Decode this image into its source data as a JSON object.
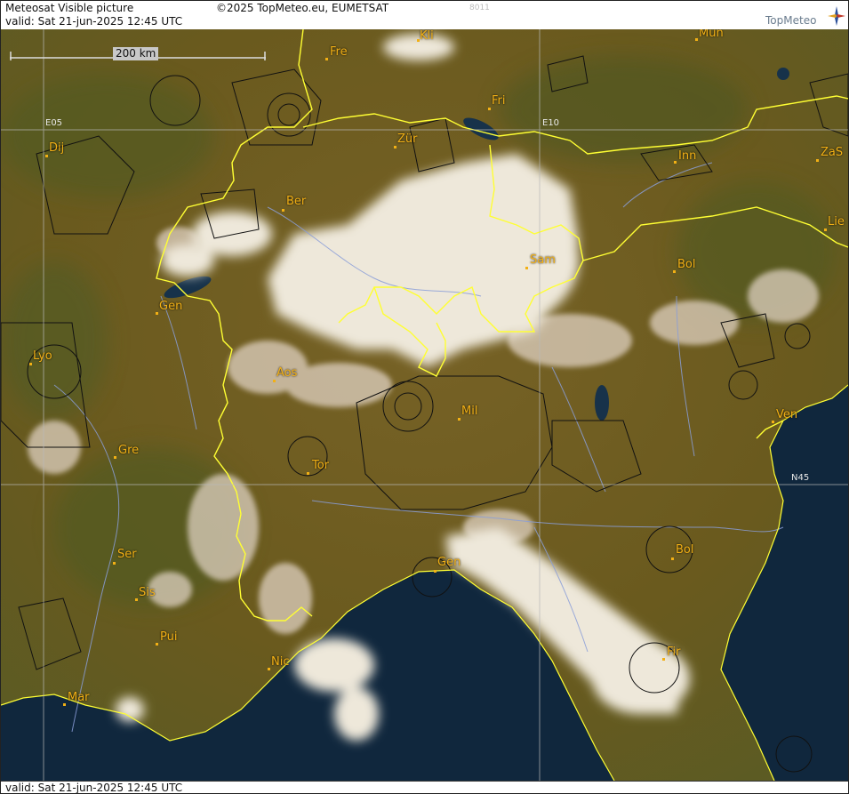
{
  "header": {
    "title": "Meteosat Visible picture",
    "copyright": "©2025 TopMeteo.eu, EUMETSAT",
    "code": "8011",
    "valid": "valid:  Sat  21-jun-2025  12:45 UTC",
    "logo": "TopMeteo"
  },
  "footer": {
    "valid": "valid:  Sat  21-jun-2025  12:45 UTC"
  },
  "scale": {
    "label": "200 km"
  },
  "grid": {
    "lon_left": "E05",
    "lon_right": "E10",
    "lat": "N45"
  },
  "colors": {
    "land": "#6e5c1f",
    "sea": "#10273d",
    "cloud": "#ece6d6",
    "border": "#ffff33",
    "river": "#8a9ed8",
    "label": "#f2b015"
  },
  "cities": [
    "Kli",
    "Mun",
    "Fre",
    "Fri",
    "Dij",
    "Zür",
    "Inn",
    "ZaS",
    "Ber",
    "Lie",
    "Sam",
    "Bol",
    "Gen",
    "Lyo",
    "Aos",
    "Mil",
    "Ven",
    "Gre",
    "Tor",
    "Ser",
    "Gen",
    "Bol",
    "Sis",
    "Pui",
    "Fir",
    "Nic",
    "Mar"
  ]
}
